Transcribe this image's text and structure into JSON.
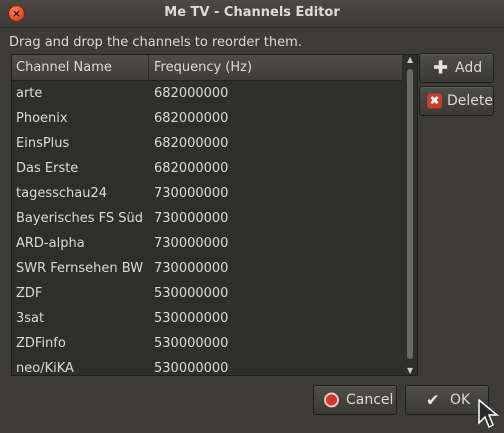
{
  "window": {
    "title": "Me TV - Channels Editor",
    "close_glyph": "×"
  },
  "instruction": "Drag and drop the channels to reorder them.",
  "table": {
    "columns": [
      "Channel Name",
      "Frequency (Hz)"
    ],
    "rows": [
      {
        "name": "arte",
        "frequency": "682000000"
      },
      {
        "name": "Phoenix",
        "frequency": "682000000"
      },
      {
        "name": "EinsPlus",
        "frequency": "682000000"
      },
      {
        "name": "Das Erste",
        "frequency": "682000000"
      },
      {
        "name": "tagesschau24",
        "frequency": "730000000"
      },
      {
        "name": "Bayerisches FS Süd",
        "frequency": "730000000"
      },
      {
        "name": "ARD-alpha",
        "frequency": "730000000"
      },
      {
        "name": "SWR Fernsehen BW",
        "frequency": "730000000"
      },
      {
        "name": "ZDF",
        "frequency": "530000000"
      },
      {
        "name": "3sat",
        "frequency": "530000000"
      },
      {
        "name": "ZDFinfo",
        "frequency": "530000000"
      },
      {
        "name": "neo/KiKA",
        "frequency": "530000000"
      }
    ]
  },
  "buttons": {
    "add": {
      "label": "Add",
      "icon": "plus-icon",
      "glyph": "✚"
    },
    "delete": {
      "label": "Delete",
      "icon": "delete-x-icon",
      "glyph": "✖"
    },
    "cancel": {
      "label": "Cancel",
      "icon": "cancel-icon"
    },
    "ok": {
      "label": "OK",
      "icon": "checkmark-icon",
      "glyph": "✔"
    }
  },
  "colors": {
    "window_bg": "#3c3b37",
    "list_bg": "#2e2e2b",
    "text": "#dfdbd2",
    "close_button": "#e8512b",
    "delete_icon": "#d03a2a"
  }
}
